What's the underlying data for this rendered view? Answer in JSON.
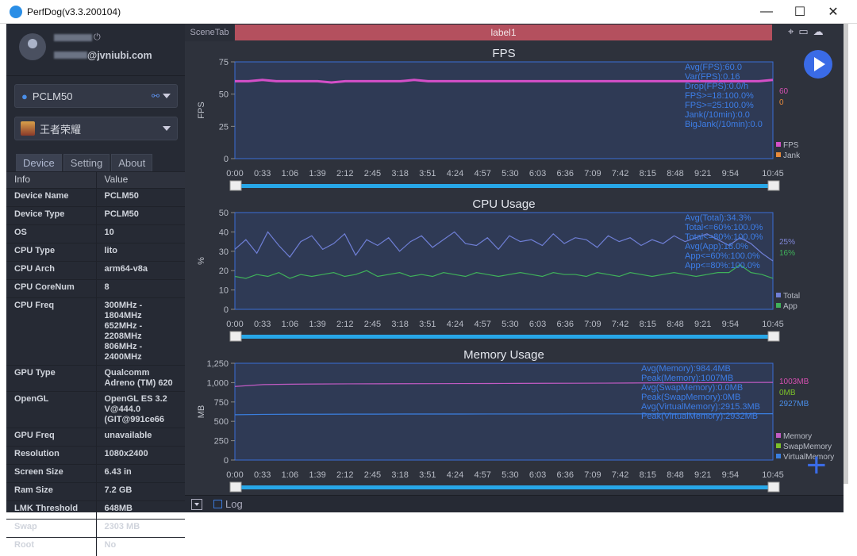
{
  "window": {
    "title": "PerfDog(v3.3.200104)",
    "minimize": "—",
    "maximize": "☐",
    "close": "✕"
  },
  "user": {
    "email_suffix": "@jvniubi.com",
    "power_icon": "⏻"
  },
  "device_select": {
    "value": "PCLM50"
  },
  "app_select": {
    "value": "王者荣耀"
  },
  "tabs": [
    "Device",
    "Setting",
    "About"
  ],
  "table": {
    "headers": [
      "Info",
      "Value"
    ],
    "rows": [
      [
        "Device Name",
        "PCLM50"
      ],
      [
        "Device Type",
        "PCLM50"
      ],
      [
        "OS",
        "10"
      ],
      [
        "CPU Type",
        "lito"
      ],
      [
        "CPU Arch",
        "arm64-v8a"
      ],
      [
        "CPU CoreNum",
        "8"
      ],
      [
        "CPU Freq",
        "300MHz - 1804MHz\n652MHz - 2208MHz\n806MHz - 2400MHz"
      ],
      [
        "GPU Type",
        "Qualcomm Adreno (TM) 620"
      ],
      [
        "OpenGL",
        "OpenGL ES 3.2 V@444.0 (GIT@991ce66"
      ],
      [
        "GPU Freq",
        "unavailable"
      ],
      [
        "Resolution",
        "1080x2400"
      ],
      [
        "Screen Size",
        "6.43 in"
      ],
      [
        "Ram Size",
        "7.2 GB"
      ],
      [
        "LMK Threshold",
        "648MB"
      ],
      [
        "Swap",
        "2303 MB"
      ],
      [
        "Root",
        "No"
      ]
    ]
  },
  "scene": {
    "tab_label": "SceneTab",
    "label": "label1"
  },
  "bottom": {
    "log_label": "Log"
  },
  "chart_data": [
    {
      "type": "line",
      "title": "FPS",
      "ylabel": "FPS",
      "ylim": [
        0,
        75
      ],
      "yticks": [
        "0",
        "25",
        "50",
        "75"
      ],
      "xticks": [
        "0:00",
        "0:33",
        "1:06",
        "1:39",
        "2:12",
        "2:45",
        "3:18",
        "3:51",
        "4:24",
        "4:57",
        "5:30",
        "6:03",
        "6:36",
        "7:09",
        "7:42",
        "8:15",
        "8:48",
        "9:21",
        "9:54",
        "10:45"
      ],
      "stats": [
        "Avg(FPS):60.0",
        "Var(FPS):0.16",
        "Drop(FPS):0.0/h",
        "FPS>=18:100.0%",
        "FPS>=25:100.0%",
        "Jank(/10min):0.0",
        "BigJank(/10min):0.0"
      ],
      "current": [
        {
          "text": "60",
          "color": "#d44fb0"
        },
        {
          "text": "0",
          "color": "#e88a3a"
        }
      ],
      "series": [
        {
          "name": "FPS",
          "color": "#d44fc8",
          "values": [
            60,
            60,
            61,
            60,
            60,
            60,
            60,
            59,
            60,
            60,
            60,
            60,
            60,
            61,
            60,
            60,
            60,
            60,
            60,
            60,
            60,
            60,
            60,
            60,
            60,
            60,
            60,
            60,
            60,
            60,
            60,
            60,
            60,
            60,
            60,
            60,
            60,
            60,
            60,
            61
          ]
        },
        {
          "name": "Jank",
          "color": "#e88a3a",
          "values": []
        }
      ]
    },
    {
      "type": "line",
      "title": "CPU Usage",
      "ylabel": "%",
      "ylim": [
        0,
        50
      ],
      "yticks": [
        "0",
        "10",
        "20",
        "30",
        "40",
        "50"
      ],
      "xticks": [
        "0:00",
        "0:33",
        "1:06",
        "1:39",
        "2:12",
        "2:45",
        "3:18",
        "3:51",
        "4:24",
        "4:57",
        "5:30",
        "6:03",
        "6:36",
        "7:09",
        "7:42",
        "8:15",
        "8:48",
        "9:21",
        "9:54",
        "10:45"
      ],
      "stats": [
        "Avg(Total):34.3%",
        "Total<=60%:100.0%",
        "Total<=80%:100.0%",
        "Avg(App):18.0%",
        "App<=60%:100.0%",
        "App<=80%:100.0%"
      ],
      "current": [
        {
          "text": "25%",
          "color": "#7f86d8"
        },
        {
          "text": "16%",
          "color": "#3fb15a"
        }
      ],
      "series": [
        {
          "name": "Total",
          "color": "#6f7fd6",
          "values": [
            31,
            36,
            29,
            40,
            33,
            27,
            35,
            38,
            31,
            34,
            39,
            28,
            36,
            33,
            37,
            30,
            35,
            38,
            32,
            36,
            40,
            34,
            33,
            37,
            31,
            38,
            35,
            36,
            33,
            39,
            34,
            37,
            36,
            32,
            38,
            35,
            37,
            33,
            36,
            34,
            38,
            35,
            37,
            39,
            36,
            33,
            37,
            34,
            29,
            25
          ]
        },
        {
          "name": "App",
          "color": "#3fb15a",
          "values": [
            17,
            16,
            18,
            17,
            19,
            16,
            18,
            17,
            18,
            19,
            17,
            18,
            20,
            17,
            18,
            19,
            17,
            18,
            17,
            19,
            18,
            17,
            19,
            18,
            17,
            18,
            19,
            18,
            17,
            19,
            18,
            18,
            17,
            19,
            18,
            17,
            19,
            18,
            17,
            18,
            19,
            18,
            17,
            18,
            19,
            19,
            23,
            19,
            18,
            16
          ]
        }
      ]
    },
    {
      "type": "line",
      "title": "Memory Usage",
      "ylabel": "MB",
      "ylim": [
        0,
        1250
      ],
      "yticks": [
        "0",
        "250",
        "500",
        "750",
        "1,000",
        "1,250"
      ],
      "xticks": [
        "0:00",
        "0:33",
        "1:06",
        "1:39",
        "2:12",
        "2:45",
        "3:18",
        "3:51",
        "4:24",
        "4:57",
        "5:30",
        "6:03",
        "6:36",
        "7:09",
        "7:42",
        "8:15",
        "8:48",
        "9:21",
        "9:54",
        "10:45"
      ],
      "stats": [
        "Avg(Memory):984.4MB",
        "Peak(Memory):1007MB",
        "Avg(SwapMemory):0.0MB",
        "Peak(SwapMemory):0MB",
        "Avg(VirtualMemory):2915.3MB",
        "Peak(VirtualMemory):2932MB"
      ],
      "current": [
        {
          "text": "1003MB",
          "color": "#d44fb0"
        },
        {
          "text": "0MB",
          "color": "#7cc12a"
        },
        {
          "text": "2927MB",
          "color": "#4a8ee8"
        }
      ],
      "series": [
        {
          "name": "Memory",
          "color": "#c25bc4",
          "values": [
            950,
            975,
            980,
            982,
            984,
            985,
            986,
            987,
            988,
            989,
            990,
            991,
            992,
            993,
            995,
            997,
            999,
            1000,
            1002,
            1003
          ]
        },
        {
          "name": "SwapMemory",
          "color": "#7cc12a",
          "values": []
        },
        {
          "name": "VirtualMemory",
          "color": "#3a7fe0",
          "values": [
            585,
            590,
            592,
            592,
            593,
            593,
            594,
            594,
            594,
            595,
            595,
            595,
            596,
            596,
            596,
            597,
            597,
            597,
            598,
            598
          ]
        }
      ]
    }
  ]
}
